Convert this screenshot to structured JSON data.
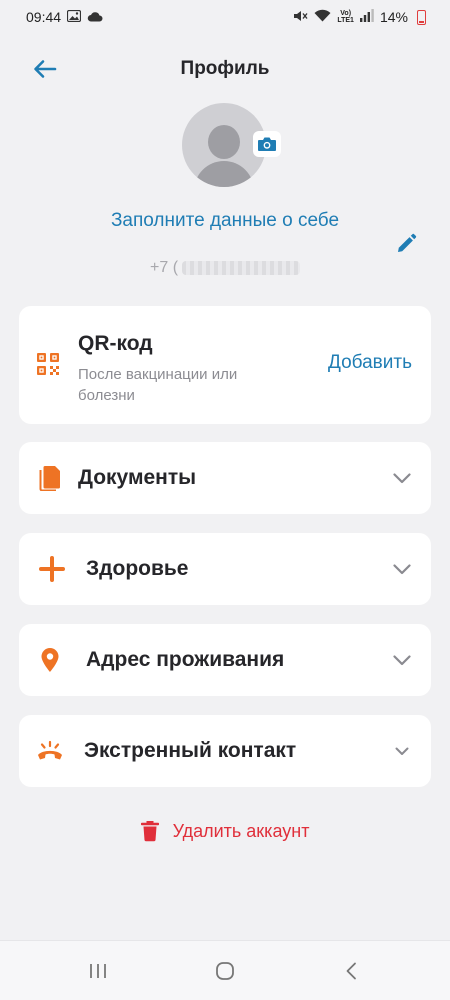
{
  "status_bar": {
    "time": "09:44",
    "battery": "14%",
    "network_label_top": "Vo)",
    "network_label_bottom": "LTE1"
  },
  "header": {
    "title": "Профиль"
  },
  "profile": {
    "fill_link": "Заполните данные о себе",
    "phone_prefix": "+7 ("
  },
  "qr": {
    "title": "QR-код",
    "subtitle": "После вакцинации или болезни",
    "add_label": "Добавить"
  },
  "sections": [
    {
      "label": "Документы",
      "icon": "document-icon"
    },
    {
      "label": "Здоровье",
      "icon": "plus-icon"
    },
    {
      "label": "Адрес проживания",
      "icon": "location-pin-icon"
    },
    {
      "label": "Экстренный контакт",
      "icon": "emergency-phone-icon"
    }
  ],
  "delete_account": {
    "label": "Удалить аккаунт"
  },
  "colors": {
    "accent_blue": "#1f7db4",
    "accent_orange": "#ee7324",
    "danger_red": "#e02f3a"
  }
}
